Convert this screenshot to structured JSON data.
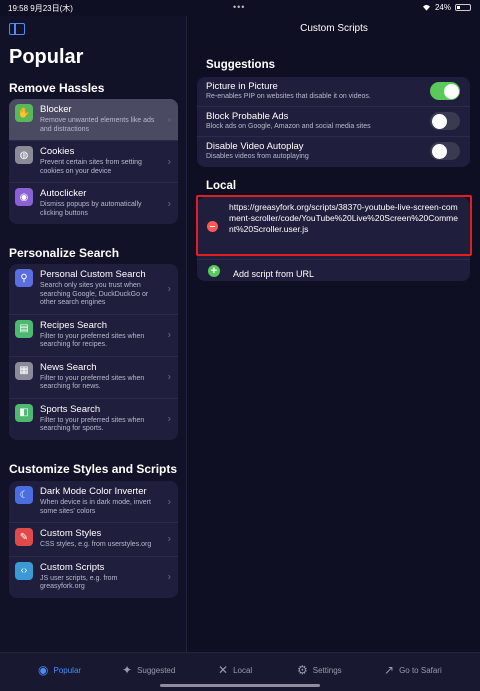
{
  "status_bar": {
    "time": "19:58",
    "date": "9月23日(木)",
    "dots": "•••",
    "battery": "24%"
  },
  "sidebar": {
    "title": "Popular",
    "sections": [
      {
        "title": "Remove Hassles",
        "items": [
          {
            "label": "Blocker",
            "desc": "Remove unwanted elements like ads and distractions",
            "icon": "hand-icon",
            "color": "#5ab85a",
            "glyph": "✋"
          },
          {
            "label": "Cookies",
            "desc": "Prevent certain sites from setting cookies on your device",
            "icon": "cookie-icon",
            "color": "#8a8a99",
            "glyph": "◍"
          },
          {
            "label": "Autoclicker",
            "desc": "Dismiss popups by automatically clicking buttons",
            "icon": "cursor-click-icon",
            "color": "#8a62d6",
            "glyph": "◉"
          }
        ]
      },
      {
        "title": "Personalize Search",
        "items": [
          {
            "label": "Personal Custom Search",
            "desc": "Search only sites you trust when searching Google, DuckDuckGo or other search engines",
            "icon": "search-icon",
            "color": "#5a6ee0",
            "glyph": "⚲"
          },
          {
            "label": "Recipes Search",
            "desc": "Filter to your preferred sites when searching for recipes.",
            "icon": "recipe-icon",
            "color": "#4cb870",
            "glyph": "▤"
          },
          {
            "label": "News Search",
            "desc": "Filter to your preferred sites when searching for news.",
            "icon": "newspaper-icon",
            "color": "#8a8a99",
            "glyph": "▦"
          },
          {
            "label": "Sports Search",
            "desc": "Filter to your preferred sites when searching for sports.",
            "icon": "sports-icon",
            "color": "#4cb870",
            "glyph": "◧"
          }
        ]
      },
      {
        "title": "Customize Styles and Scripts",
        "items": [
          {
            "label": "Dark Mode Color Inverter",
            "desc": "When device is in dark mode, invert some sites' colors",
            "icon": "moon-icon",
            "color": "#4a6ee0",
            "glyph": "☾"
          },
          {
            "label": "Custom Styles",
            "desc": "CSS styles, e.g. from userstyles.org",
            "icon": "paintbrush-icon",
            "color": "#e04a4a",
            "glyph": "✎"
          },
          {
            "label": "Custom Scripts",
            "desc": "JS user scripts, e.g. from greasyfork.org",
            "icon": "code-icon",
            "color": "#3a9ad6",
            "glyph": "‹›"
          }
        ]
      }
    ]
  },
  "main": {
    "title": "Custom Scripts",
    "suggestions_title": "Suggestions",
    "suggestions": [
      {
        "label": "Picture in Picture",
        "desc": "Re-enables PIP on websites that disable it on videos.",
        "on": true
      },
      {
        "label": "Block Probable Ads",
        "desc": "Block ads on Google, Amazon and social media sites",
        "on": false
      },
      {
        "label": "Disable Video Autoplay",
        "desc": "Disables videos from autoplaying",
        "on": false
      }
    ],
    "local_title": "Local",
    "script_url": "https://greasyfork.org/scripts/38370-youtube-live-screen-comment-scroller/code/YouTube%20Live%20Screen%20Comment%20Scroller.user.js",
    "add_label": "Add script from URL"
  },
  "tabbar": [
    {
      "label": "Popular",
      "icon": "compass-icon",
      "glyph": "◉",
      "active": true
    },
    {
      "label": "Suggested",
      "icon": "sparkles-icon",
      "glyph": "✦",
      "active": false
    },
    {
      "label": "Local",
      "icon": "tools-icon",
      "glyph": "✕",
      "active": false
    },
    {
      "label": "Settings",
      "icon": "gear-icon",
      "glyph": "⚙",
      "active": false
    },
    {
      "label": "Go to Safari",
      "icon": "arrow-up-right-icon",
      "glyph": "↗",
      "active": false
    }
  ]
}
